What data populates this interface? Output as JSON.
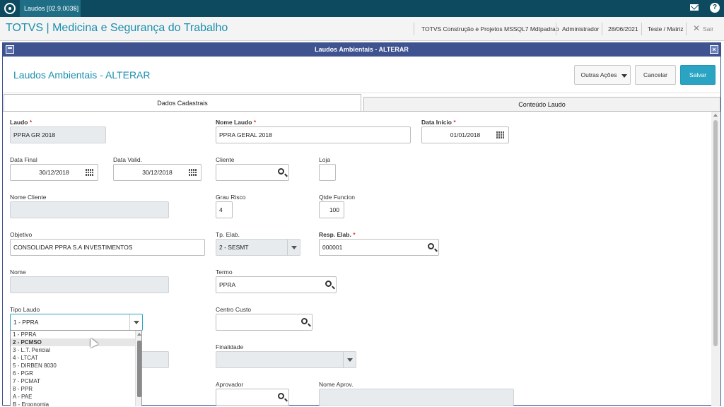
{
  "topbar": {
    "tab_label": "Laudos [02.9.0035]",
    "tab_close": "×",
    "help_label": "?"
  },
  "app": {
    "title": "TOTVS | Medicina e Segurança do Trabalho",
    "company": "TOTVS Construção e Projetos MSSQL7 Mdtpadrao",
    "user": "Administrador",
    "date": "28/06/2021",
    "branch": "Teste / Matriz",
    "exit_label": "Sair",
    "exit_x": "✕"
  },
  "dialog": {
    "window_title": "Laudos Ambientais - ALTERAR",
    "close_x": "×",
    "page_title": "Laudos Ambientais - ALTERAR",
    "buttons": {
      "other": "Outras Ações",
      "cancel": "Cancelar",
      "save": "Salvar"
    },
    "tabs": [
      "Dados Cadastrais",
      "Conteúdo Laudo"
    ]
  },
  "form": {
    "laudo": {
      "label": "Laudo",
      "value": "PPRA GR 2018"
    },
    "nome_laudo": {
      "label": "Nome Laudo",
      "value": "PPRA GERAL 2018"
    },
    "data_inicio": {
      "label": "Data Início",
      "value": "01/01/2018"
    },
    "data_final": {
      "label": "Data Final",
      "value": "30/12/2018"
    },
    "data_valid": {
      "label": "Data Valid.",
      "value": "30/12/2018"
    },
    "cliente": {
      "label": "Cliente",
      "value": ""
    },
    "loja": {
      "label": "Loja",
      "value": ""
    },
    "nome_cliente": {
      "label": "Nome Cliente",
      "value": ""
    },
    "grau_risco": {
      "label": "Grau Risco",
      "value": "4"
    },
    "qtde_funcion": {
      "label": "Qtde Funcion",
      "value": "100"
    },
    "objetivo": {
      "label": "Objetivo",
      "value": "CONSOLIDAR PPRA S.A INVESTIMENTOS"
    },
    "tp_elab": {
      "label": "Tp. Elab.",
      "value": "2 - SESMT"
    },
    "resp_elab": {
      "label": "Resp. Elab.",
      "value": "000001"
    },
    "nome": {
      "label": "Nome",
      "value": ""
    },
    "termo": {
      "label": "Termo",
      "value": "PPRA"
    },
    "tipo_laudo": {
      "label": "Tipo Laudo",
      "value": "1 - PPRA"
    },
    "centro_custo": {
      "label": "Centro Custo",
      "value": ""
    },
    "finalidade": {
      "label": "Finalidade",
      "value": ""
    },
    "aprovador": {
      "label": "Aprovador",
      "value": ""
    },
    "nome_aprov": {
      "label": "Nome Aprov.",
      "value": ""
    },
    "required_mark": "*"
  },
  "tipo_laudo_options": [
    "1 - PPRA",
    "2 - PCMSO",
    "3 - L.T. Pericial",
    "4 - LTCAT",
    "5 - DIRBEN 8030",
    "6 - PGR",
    "7 - PCMAT",
    "8 - PPR",
    "A - PAE",
    "B - Ergonomia"
  ],
  "colors": {
    "topbar": "#0d4a5f",
    "accent": "#1b8fae",
    "dialog_bar": "#3f5390",
    "save_button": "#2ba4c4",
    "required": "#d33333"
  }
}
